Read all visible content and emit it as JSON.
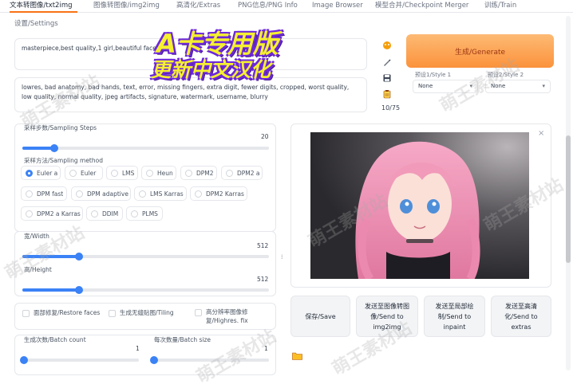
{
  "tabs": [
    {
      "label": "文本转图像/txt2img",
      "active": true
    },
    {
      "label": "图像转图像/img2img",
      "active": false
    },
    {
      "label": "高清化/Extras",
      "active": false
    },
    {
      "label": "PNG信息/PNG Info",
      "active": false
    },
    {
      "label": "Image Browser",
      "active": false
    },
    {
      "label": "模型合并/Checkpoint Merger",
      "active": false
    },
    {
      "label": "训练/Train",
      "active": false
    }
  ],
  "settings_tab": "设置/Settings",
  "overlay": {
    "line1": "A卡专用版",
    "line2": "更新中文汉化"
  },
  "prompt": {
    "value": "masterpiece,best quality,1 girl,beautiful face"
  },
  "negative_prompt": {
    "value": "lowres, bad anatomy, bad hands, text, error, missing fingers, extra digit, fewer digits, cropped, worst quality, low quality, normal quality, jpeg artifacts, signature, watermark, username, blurry"
  },
  "token_counter": "10/75",
  "generate_label": "生成/Generate",
  "style1": {
    "label": "预设1/Style 1",
    "value": "None"
  },
  "style2": {
    "label": "预设2/Style 2",
    "value": "None"
  },
  "sampling_steps": {
    "label": "采样步数/Sampling Steps",
    "value": "20",
    "fraction": 0.13
  },
  "sampling_method": {
    "label": "采样方法/Sampling method",
    "options": [
      "Euler a",
      "Euler",
      "LMS",
      "Heun",
      "DPM2",
      "DPM2 a",
      "DPM fast",
      "DPM adaptive",
      "LMS Karras",
      "DPM2 Karras",
      "DPM2 a Karras",
      "DDIM",
      "PLMS"
    ],
    "selected": "Euler a"
  },
  "width": {
    "label": "宽/Width",
    "value": "512",
    "fraction": 0.23
  },
  "height": {
    "label": "高/Height",
    "value": "512",
    "fraction": 0.23
  },
  "checkboxes": {
    "restore_faces": "面部修复/Restore faces",
    "tiling": "生成无缝贴图/Tiling",
    "highres_fix": "高分辨率图像修复/Highres. fix"
  },
  "batch_count": {
    "label": "生成次数/Batch count",
    "value": "1",
    "fraction": 0.0
  },
  "batch_size": {
    "label": "每次数量/Batch size",
    "value": "1",
    "fraction": 0.0
  },
  "actions": {
    "save": "保存/Save",
    "send_img2img": "发送至图像转图像/Send to img2img",
    "send_inpaint": "发送至局部绘制/Send to inpaint",
    "send_extras": "发送至高清化/Send to extras"
  },
  "watermark_text": "萌王素材站",
  "colors": {
    "accent": "#f97316",
    "slider": "#3b82f6",
    "overlay_fill": "#f5f030",
    "overlay_outline": "#6d28d9"
  }
}
